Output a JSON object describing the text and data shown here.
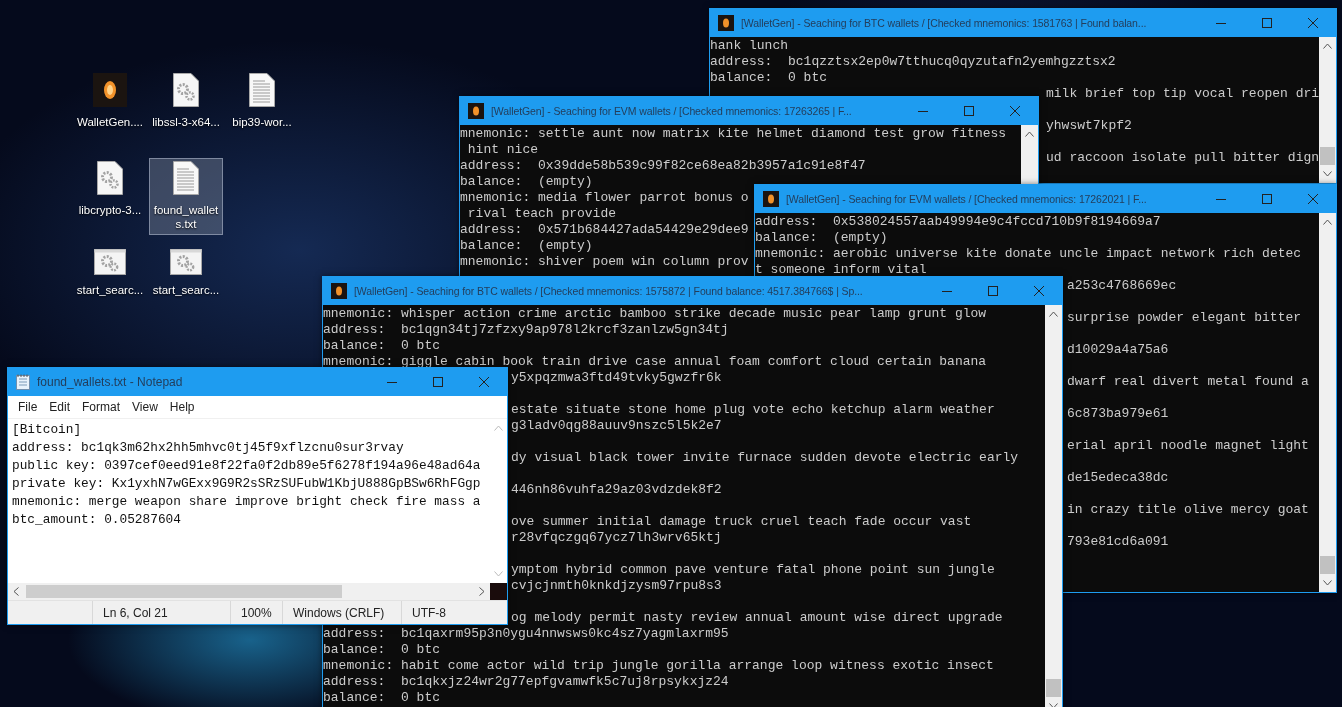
{
  "desktop": {
    "icon_rows": [
      [
        {
          "kind": "app",
          "label": "WalletGen....",
          "selected": false
        },
        {
          "kind": "library",
          "label": "libssl-3-x64...",
          "selected": false
        },
        {
          "kind": "text",
          "label": "bip39-wor...",
          "selected": false
        }
      ],
      [
        {
          "kind": "library",
          "label": "libcrypto-3...",
          "selected": false
        },
        {
          "kind": "text",
          "label": "found_wallets.txt",
          "selected": true
        }
      ],
      [
        {
          "kind": "script",
          "label": "start_searc...",
          "selected": false
        },
        {
          "kind": "script",
          "label": "start_searc...",
          "selected": false
        }
      ]
    ]
  },
  "windows": [
    {
      "kind": "console",
      "title": "[WalletGen] - Seaching for BTC wallets / [Checked mnemonics: 1581763 | Found balan...",
      "lines": [
        {
          "kind": "full",
          "text": "hank lunch"
        },
        {
          "kind": "full",
          "text": "address:  bc1qzztsx2ep0w7tthucq0qyzutafn2yemhgzztsx2"
        },
        {
          "kind": "full",
          "text": "balance:  0 btc"
        },
        {
          "kind": "tail",
          "text": "milk brief top tip vocal reopen dri"
        },
        {
          "kind": "gap"
        },
        {
          "kind": "tail",
          "text": "yhwswt7kpf2"
        },
        {
          "kind": "gap"
        },
        {
          "kind": "tail",
          "text": "ud raccoon isolate pull bitter dign"
        }
      ]
    },
    {
      "kind": "console",
      "title": "[WalletGen] - Seaching for EVM wallets / [Checked mnemonics: 17263265 | F...",
      "lines": [
        {
          "kind": "full",
          "text": "mnemonic: settle aunt now matrix kite helmet diamond test grow fitness"
        },
        {
          "kind": "full",
          "text": " hint nice"
        },
        {
          "kind": "full",
          "text": "address:  0x39dde58b539c99f82ce68ea82b3957a1c91e8f47"
        },
        {
          "kind": "full",
          "text": "balance:  (empty)"
        },
        {
          "kind": "full",
          "text": "mnemonic: media flower parrot bonus o"
        },
        {
          "kind": "full",
          "text": " rival teach provide"
        },
        {
          "kind": "full",
          "text": "address:  0x571b684427ada54429e29dee9"
        },
        {
          "kind": "full",
          "text": "balance:  (empty)"
        },
        {
          "kind": "full",
          "text": "mnemonic: shiver poem win column prov"
        }
      ]
    },
    {
      "kind": "console",
      "title": "[WalletGen] - Seaching for EVM wallets / [Checked mnemonics: 17262021 | F...",
      "lines": [
        {
          "kind": "full",
          "text": "address:  0x538024557aab49994e9c4fccd710b9f8194669a7"
        },
        {
          "kind": "full",
          "text": "balance:  (empty)"
        },
        {
          "kind": "full",
          "text": "mnemonic: aerobic universe kite donate uncle impact network rich detec"
        },
        {
          "kind": "full",
          "text": "t someone inform vital"
        },
        {
          "kind": "tail",
          "text": "a253c4768669ec"
        },
        {
          "kind": "gap"
        },
        {
          "kind": "tail",
          "text": "surprise powder elegant bitter"
        },
        {
          "kind": "gap"
        },
        {
          "kind": "tail",
          "text": "d10029a4a75a6"
        },
        {
          "kind": "gap"
        },
        {
          "kind": "tail",
          "text": "dwarf real divert metal found a"
        },
        {
          "kind": "gap"
        },
        {
          "kind": "tail",
          "text": "6c873ba979e61"
        },
        {
          "kind": "gap"
        },
        {
          "kind": "tail",
          "text": "erial april noodle magnet light"
        },
        {
          "kind": "gap"
        },
        {
          "kind": "tail",
          "text": "de15edeca38dc"
        },
        {
          "kind": "gap"
        },
        {
          "kind": "tail",
          "text": "in crazy title olive mercy goat"
        },
        {
          "kind": "gap"
        },
        {
          "kind": "tail",
          "text": "793e81cd6a091"
        }
      ]
    },
    {
      "kind": "console",
      "title": "[WalletGen] - Seaching for BTC wallets / [Checked mnemonics: 1575872 | Found balance: 4517.384766$ | Sp...",
      "lines": [
        {
          "kind": "full",
          "text": "mnemonic: whisper action crime arctic bamboo strike decade music pear lamp grunt glow"
        },
        {
          "kind": "full",
          "text": "address:  bc1qgn34tj7zfzxy9ap978l2krcf3zanlzw5gn34tj"
        },
        {
          "kind": "full",
          "text": "balance:  0 btc"
        },
        {
          "kind": "full",
          "text": "mnemonic: giggle cabin book train drive case annual foam comfort cloud certain banana"
        },
        {
          "kind": "tail",
          "text": "y5xpqzmwa3ftd49tvky5gwzfr6k"
        },
        {
          "kind": "gap"
        },
        {
          "kind": "tail",
          "text": "estate situate stone home plug vote echo ketchup alarm weather"
        },
        {
          "kind": "tail",
          "text": "g3ladv0qg88auuv9nszc5l5k2e7"
        },
        {
          "kind": "gap"
        },
        {
          "kind": "tail",
          "text": "dy visual black tower invite furnace sudden devote electric early"
        },
        {
          "kind": "gap"
        },
        {
          "kind": "tail",
          "text": "446nh86vuhfa29az03vdzdek8f2"
        },
        {
          "kind": "gap"
        },
        {
          "kind": "tail",
          "text": "ove summer initial damage truck cruel teach fade occur vast"
        },
        {
          "kind": "tail",
          "text": "r28vfqczgq67ycz7lh3wrv65ktj"
        },
        {
          "kind": "gap"
        },
        {
          "kind": "tail",
          "text": "ymptom hybrid common pave venture fatal phone point sun jungle"
        },
        {
          "kind": "tail",
          "text": "cvjcjnmth0knkdjzysm97rpu8s3"
        },
        {
          "kind": "gap"
        },
        {
          "kind": "tail",
          "text": "og melody permit nasty review annual amount wise direct upgrade"
        },
        {
          "kind": "full",
          "text": "address:  bc1qaxrm95p3n0ygu4nnwsws0kc4sz7yagmlaxrm95"
        },
        {
          "kind": "full",
          "text": "balance:  0 btc"
        },
        {
          "kind": "full",
          "text": "mnemonic: habit come actor wild trip jungle gorilla arrange loop witness exotic insect"
        },
        {
          "kind": "full",
          "text": "address:  bc1qkxjz24wr2g77epfgvamwfk5c7uj8rpsykxjz24"
        },
        {
          "kind": "full",
          "text": "balance:  0 btc"
        }
      ]
    },
    {
      "kind": "notepad",
      "title": "found_wallets.txt - Notepad",
      "menu": [
        "File",
        "Edit",
        "Format",
        "View",
        "Help"
      ],
      "lines": [
        "[Bitcoin]",
        "address: bc1qk3m62hx2hh5mhvc0tj45f9xflzcnu0sur3rvay",
        "public key: 0397cef0eed91e8f22fa0f2db89e5f6278f194a96e48ad64a",
        "private key: Kx1yxhN7wGExx9G9R2sSRzSUFubW1KbjU888GpBSw6RhFGgp",
        "mnemonic: merge weapon share improve bright check fire mass a",
        "btc_amount: 0.05287604"
      ],
      "status": [
        "Ln 6, Col 21",
        "100%",
        "Windows (CRLF)",
        "UTF-8"
      ]
    }
  ]
}
